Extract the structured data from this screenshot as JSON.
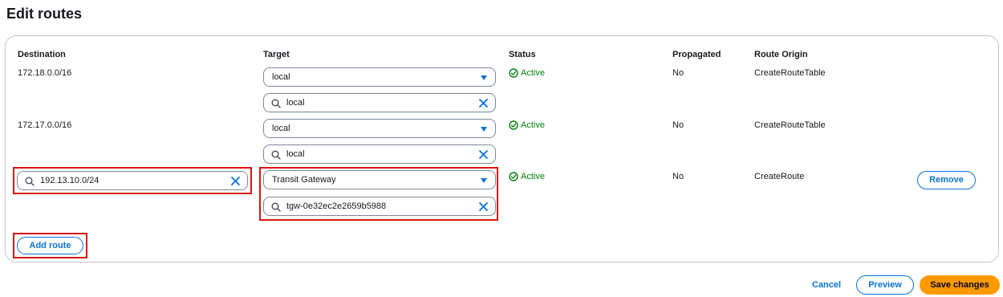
{
  "page": {
    "title": "Edit routes"
  },
  "table": {
    "columns": {
      "destination": "Destination",
      "target": "Target",
      "status": "Status",
      "propagated": "Propagated",
      "route_origin": "Route Origin"
    },
    "rows": [
      {
        "destination": "172.18.0.0/16",
        "target_type": "local",
        "target_search": "local",
        "status": "Active",
        "propagated": "No",
        "route_origin": "CreateRouteTable"
      },
      {
        "destination": "172.17.0.0/16",
        "target_type": "local",
        "target_search": "local",
        "status": "Active",
        "propagated": "No",
        "route_origin": "CreateRouteTable"
      },
      {
        "destination": "192.13.10.0/24",
        "target_type": "Transit Gateway",
        "target_search": "tgw-0e32ec2e2659b5988",
        "status": "Active",
        "propagated": "No",
        "route_origin": "CreateRoute",
        "remove_label": "Remove"
      }
    ]
  },
  "actions": {
    "add_route": "Add route",
    "cancel": "Cancel",
    "preview": "Preview",
    "save": "Save changes"
  },
  "colors": {
    "accent": "#0972d3",
    "status_ok": "#037f0c",
    "primary_button": "#ff9900",
    "highlight": "#d91515"
  },
  "icons": {
    "caret": "caret-down-icon",
    "search": "search-icon",
    "clear": "close-icon",
    "status": "check-circle-icon"
  }
}
